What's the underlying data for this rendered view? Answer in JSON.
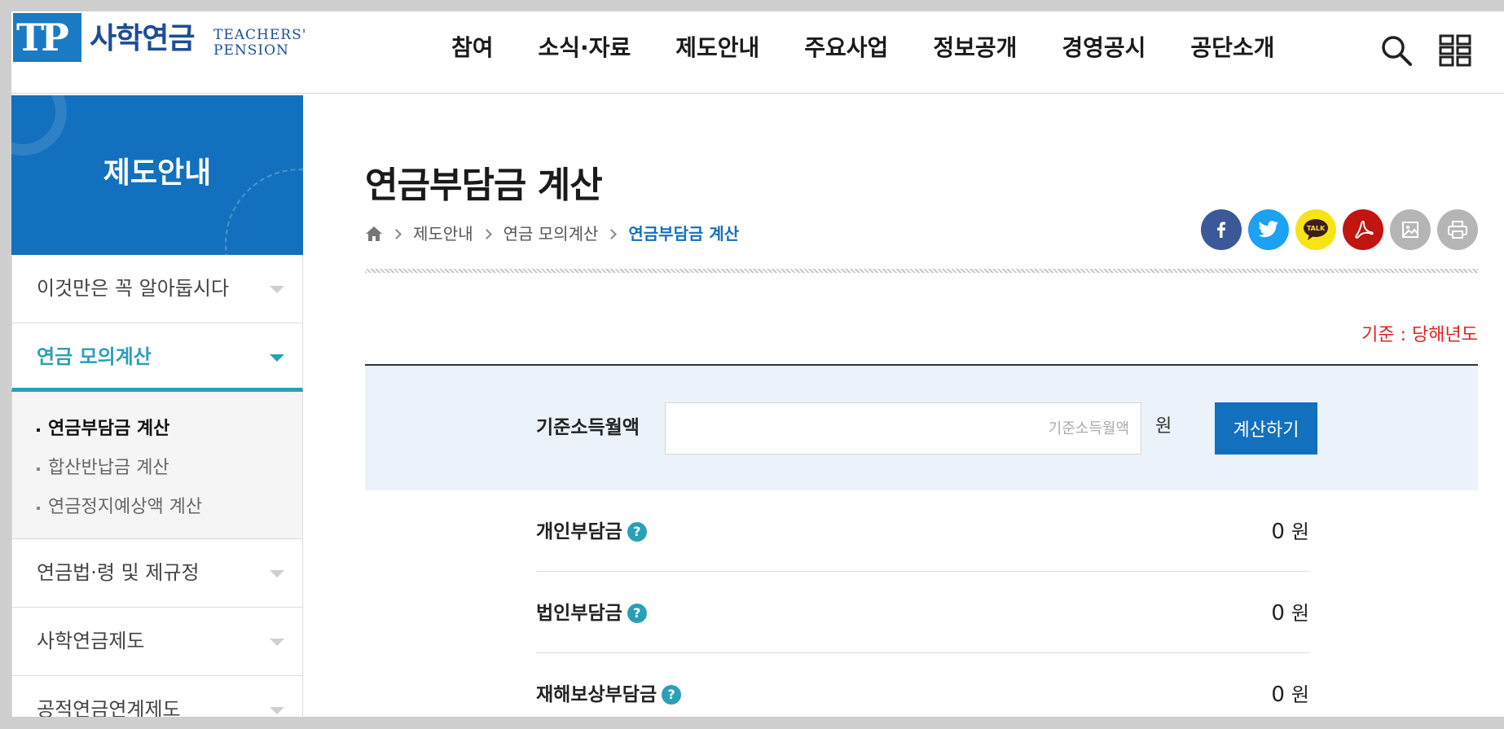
{
  "header": {
    "logo_mark": "TP",
    "logo_kr": "사학연금",
    "logo_en_line1": "TEACHERS'",
    "logo_en_line2": "PENSION",
    "nav": [
      "참여",
      "소식·자료",
      "제도안내",
      "주요사업",
      "정보공개",
      "경영공시",
      "공단소개"
    ]
  },
  "sidebar": {
    "title": "제도안내",
    "items": [
      {
        "label": "이것만은 꼭 알아둡시다"
      },
      {
        "label": "연금 모의계산"
      },
      {
        "label": "연금법·령 및 제규정"
      },
      {
        "label": "사학연금제도"
      },
      {
        "label": "공적연금연계제도"
      }
    ],
    "sub_items": [
      "연금부담금 계산",
      "합산반납금 계산",
      "연금정지예상액 계산"
    ]
  },
  "main": {
    "title": "연금부담금 계산",
    "breadcrumb": [
      "제도안내",
      "연금 모의계산",
      "연금부담금 계산"
    ],
    "basis": "기준 : 당해년도",
    "calc": {
      "label": "기준소득월액",
      "placeholder": "기준소득월액",
      "value": "",
      "unit": "원",
      "button": "계산하기"
    },
    "results": [
      {
        "label": "개인부담금",
        "value": "0",
        "unit": "원"
      },
      {
        "label": "법인부담금",
        "value": "0",
        "unit": "원"
      },
      {
        "label": "재해보상부담금",
        "value": "0",
        "unit": "원"
      }
    ],
    "share": [
      "facebook",
      "twitter",
      "kakaotalk",
      "pdf",
      "image",
      "print"
    ],
    "kakao_text": "TALK"
  },
  "colors": {
    "primary": "#1370be",
    "accent": "#2aa0b7",
    "basis_red": "#dd2222",
    "calc_bg": "#ebf2fa"
  }
}
